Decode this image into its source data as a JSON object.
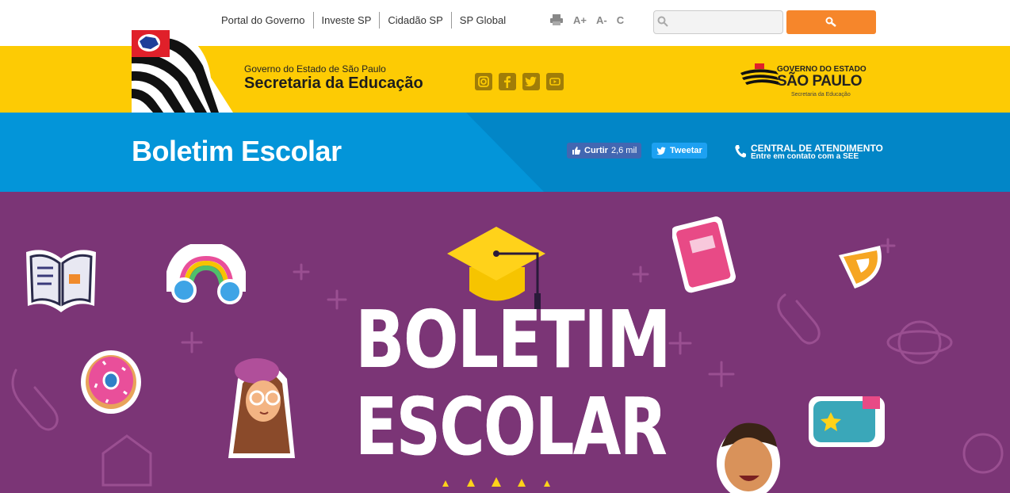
{
  "top_nav": {
    "links": [
      "Portal do Governo",
      "Investe SP",
      "Cidadão SP",
      "SP Global"
    ],
    "a11y": {
      "increase": "A+",
      "decrease": "A-",
      "contrast": "C"
    },
    "search_placeholder": ""
  },
  "header": {
    "subtitle": "Governo do Estado de São Paulo",
    "title": "Secretaria da Educação",
    "social_icons": [
      "instagram-icon",
      "facebook-icon",
      "twitter-icon",
      "youtube-icon"
    ],
    "logo": {
      "line1": "GOVERNO DO ESTADO",
      "line2": "SÃO PAULO",
      "line3": "Secretaria da Educação"
    }
  },
  "title_bar": {
    "page_title": "Boletim Escolar",
    "like_label": "Curtir",
    "like_count": "2,6 mil",
    "tweet_label": "Tweetar",
    "contact_title": "CENTRAL DE ATENDIMENTO",
    "contact_sub": "Entre em contato com a SEE"
  },
  "banner": {
    "line1": "BOLETIM",
    "line2": "ESCOLAR"
  },
  "colors": {
    "yellow": "#fdcb04",
    "blue": "#0395d9",
    "purple": "#7b3576",
    "orange": "#f6862b"
  }
}
